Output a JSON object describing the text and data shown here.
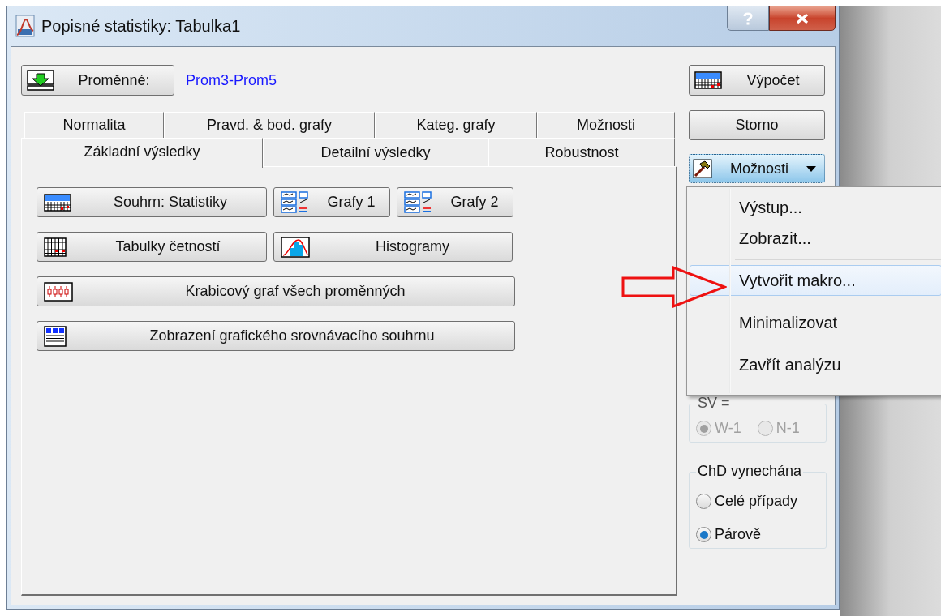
{
  "window": {
    "title": "Popisné statistiky: Tabulka1"
  },
  "variables": {
    "button": "Proměnné:",
    "value": "Prom3-Prom5"
  },
  "tabs_back": [
    {
      "label": "Normalita",
      "selected": false
    },
    {
      "label": "Pravd. & bod. grafy",
      "selected": false
    },
    {
      "label": "Kateg. grafy",
      "selected": false
    },
    {
      "label": "Možnosti",
      "selected": false
    }
  ],
  "tabs_front": [
    {
      "label": "Základní výsledky",
      "selected": true
    },
    {
      "label": "Detailní výsledky",
      "selected": false
    },
    {
      "label": "Robustnost",
      "selected": false
    }
  ],
  "panel_buttons": [
    [
      {
        "label": "Souhrn: Statistiky",
        "kind": "summary"
      },
      {
        "label": "Grafy 1",
        "kind": "graphs"
      },
      {
        "label": "Grafy 2",
        "kind": "graphs"
      }
    ],
    [
      {
        "label": "Tabulky četností",
        "kind": "frequency"
      },
      {
        "label": "Histogramy",
        "kind": "histogram"
      }
    ],
    [
      {
        "label": "Krabicový graf všech proměnných",
        "kind": "boxplot"
      }
    ],
    [
      {
        "label": "Zobrazení grafického srovnávacího souhrnu",
        "kind": "grid"
      }
    ]
  ],
  "side_buttons": [
    {
      "label": "Výpočet",
      "kind": "icon"
    },
    {
      "label": "Storno",
      "kind": "plain"
    },
    {
      "label": "Možnosti",
      "kind": "menu",
      "pressed": true
    }
  ],
  "sv_group": {
    "legend": "SV =",
    "disabled": true,
    "options": [
      {
        "label": "W-1",
        "selected": true
      },
      {
        "label": "N-1",
        "selected": false
      }
    ]
  },
  "missing_group": {
    "legend": "ChD vynechána",
    "disabled": false,
    "options": [
      {
        "label": "Celé případy",
        "selected": false
      },
      {
        "label": "Párově",
        "selected": true
      }
    ]
  },
  "menu": {
    "items": [
      {
        "kind": "item",
        "label": "Výstup...",
        "selected": false
      },
      {
        "kind": "item",
        "label": "Zobrazit...",
        "selected": false
      },
      {
        "kind": "separator"
      },
      {
        "kind": "item",
        "label": "Vytvořit makro...",
        "selected": true
      },
      {
        "kind": "separator"
      },
      {
        "kind": "item",
        "label": "Minimalizovat",
        "selected": false
      },
      {
        "kind": "separator"
      },
      {
        "kind": "item",
        "label": "Zavřít analýzu",
        "selected": false
      }
    ]
  }
}
